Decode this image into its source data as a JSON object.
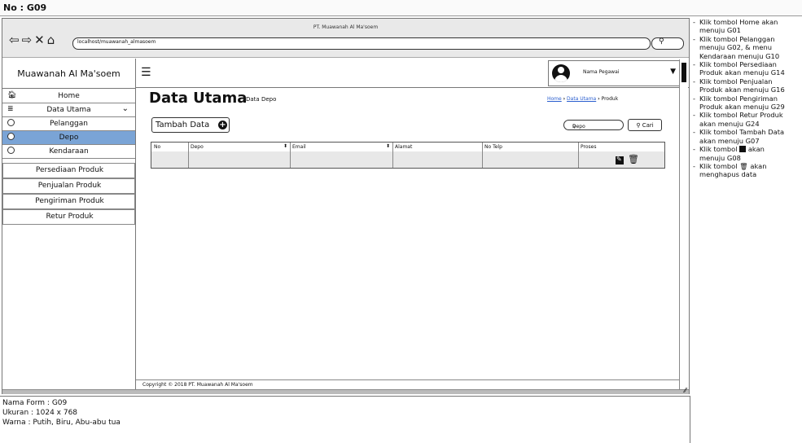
{
  "form_label": "No : G09",
  "browser": {
    "page_title": "PT. Muawanah Al Ma'soem",
    "url": "localhost/muawanah_almasoem",
    "nav_icons": [
      "back-icon",
      "forward-icon",
      "close-icon",
      "home-icon"
    ]
  },
  "sidebar": {
    "brand": "Muawanah Al Ma'soem",
    "items": [
      {
        "label": "Home",
        "icon": "home-icon"
      },
      {
        "label": "Data Utama",
        "icon": "database-icon"
      },
      {
        "label": "Pelanggan",
        "icon": "radio-icon"
      },
      {
        "label": "Depo",
        "icon": "radio-icon",
        "active": true
      },
      {
        "label": "Kendaraan",
        "icon": "radio-icon"
      },
      {
        "label": "Persediaan Produk"
      },
      {
        "label": "Penjualan Produk"
      },
      {
        "label": "Pengiriman Produk"
      },
      {
        "label": "Retur Produk"
      }
    ]
  },
  "header": {
    "user_name": "Nama Pegawai"
  },
  "content": {
    "title": "Data Utama",
    "subtitle": "Data Depo",
    "breadcrumb": [
      "Home",
      "Data Utama",
      "Produk"
    ],
    "add_button": "Tambah Data",
    "search_value": "Depo",
    "search_button": "Cari",
    "table": {
      "columns": [
        "No",
        "Depo",
        "Email",
        "Alamat",
        "No Telp",
        "Proses"
      ]
    },
    "copyright": "Copyright © 2018 PT. Muawanah Al Ma'soem"
  },
  "form_info": {
    "nama": "Nama Form : G09",
    "ukuran": "Ukuran : 1024 x 768",
    "warna": "Warna : Putih, Biru, Abu-abu tua"
  },
  "notes": [
    "Klik tombol Home akan",
    "menuju G01",
    "Klik tombol Pelanggan",
    "menuju G02, & menu",
    "Kendaraan menuju G10",
    "Klik tombol Persediaan",
    "Produk akan menuju G14",
    "Klik tombol Penjualan",
    "Produk akan menuju G16",
    "Klik tombol Pengiriman",
    "Produk akan menuju G29",
    "Klik tombol Retur Produk",
    "akan menuju G24",
    "Klik tombol Tambah Data",
    "akan menuju G07",
    "Klik tombol",
    "akan",
    "menuju G08",
    "Klik tombol",
    "akan",
    "menghapus data"
  ],
  "colors": {
    "active_item": "#7aa4d6",
    "link": "#2b5fcf",
    "chrome": "#e9e9e9"
  }
}
